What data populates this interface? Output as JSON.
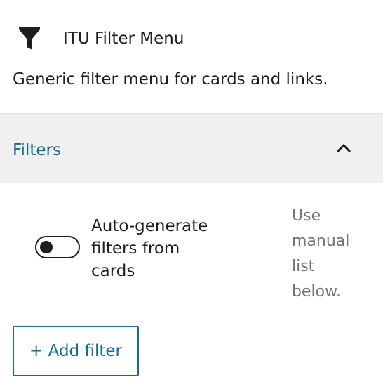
{
  "block": {
    "icon": "funnel-icon",
    "title": "ITU Filter Menu",
    "description": "Generic filter menu for cards and links."
  },
  "panel": {
    "title": "Filters",
    "expanded": true,
    "chevron_icon": "chevron-up-icon"
  },
  "auto_generate": {
    "label": "Auto-generate filters from cards",
    "enabled": false,
    "help": "Use manual list below."
  },
  "add_filter": {
    "label": "+ Add filter"
  },
  "colors": {
    "accent": "#1a6b91",
    "panel_background": "#f0f0f0",
    "help_text": "#757575"
  }
}
